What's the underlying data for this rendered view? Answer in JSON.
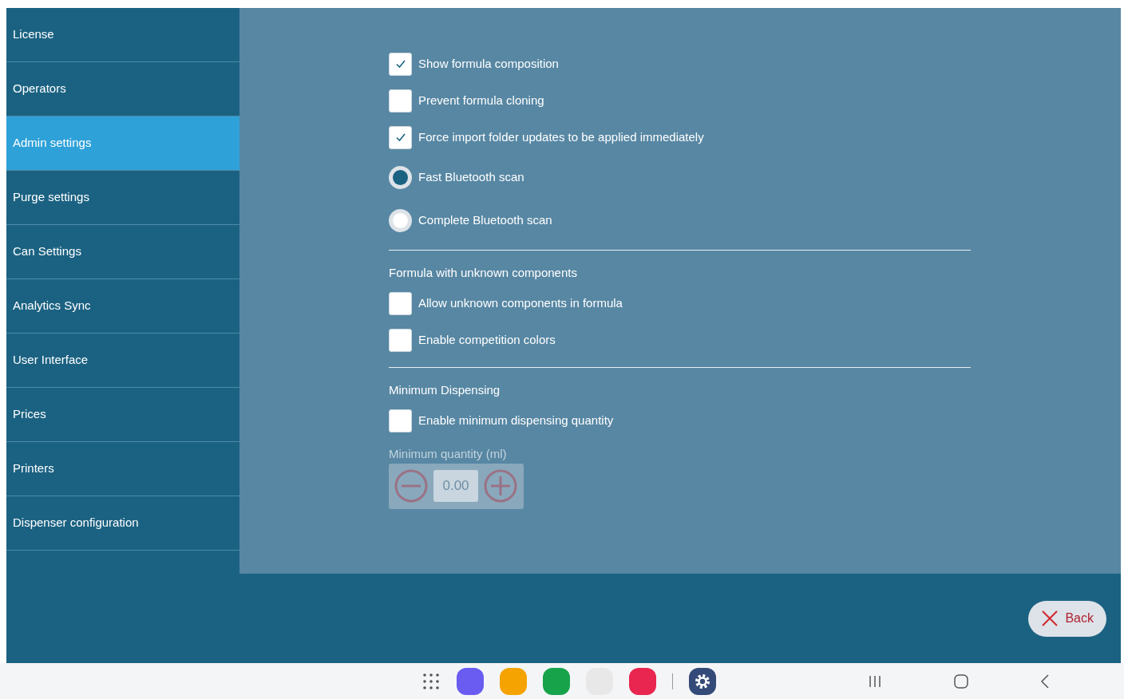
{
  "sidebar": {
    "items": [
      {
        "label": "License",
        "selected": false
      },
      {
        "label": "Operators",
        "selected": false
      },
      {
        "label": "Admin settings",
        "selected": true
      },
      {
        "label": "Purge settings",
        "selected": false
      },
      {
        "label": "Can Settings",
        "selected": false
      },
      {
        "label": "Analytics Sync",
        "selected": false
      },
      {
        "label": "User Interface",
        "selected": false
      },
      {
        "label": "Prices",
        "selected": false
      },
      {
        "label": "Printers",
        "selected": false
      },
      {
        "label": "Dispenser configuration",
        "selected": false
      }
    ]
  },
  "sections": [
    {
      "items": [
        {
          "kind": "checkbox",
          "label": "Show formula composition",
          "checked": true
        },
        {
          "kind": "checkbox",
          "label": "Prevent formula cloning",
          "checked": false
        },
        {
          "kind": "checkbox",
          "label": "Force import folder updates to be applied immediately",
          "checked": true
        },
        {
          "kind": "radio",
          "label": "Fast Bluetooth scan",
          "selected": true
        },
        {
          "kind": "radio",
          "label": "Complete Bluetooth scan",
          "selected": false
        }
      ]
    },
    {
      "title": "Formula with unknown components",
      "items": [
        {
          "kind": "checkbox",
          "label": "Allow unknown components in formula",
          "checked": false
        },
        {
          "kind": "checkbox",
          "label": "Enable competition colors",
          "checked": false
        }
      ]
    },
    {
      "title": "Minimum Dispensing",
      "items": [
        {
          "kind": "checkbox",
          "label": "Enable minimum dispensing quantity",
          "checked": false
        },
        {
          "kind": "stepper",
          "label": "Minimum quantity (ml)",
          "value": "0.00",
          "disabled": true
        }
      ]
    }
  ],
  "back_button": {
    "label": "Back"
  }
}
